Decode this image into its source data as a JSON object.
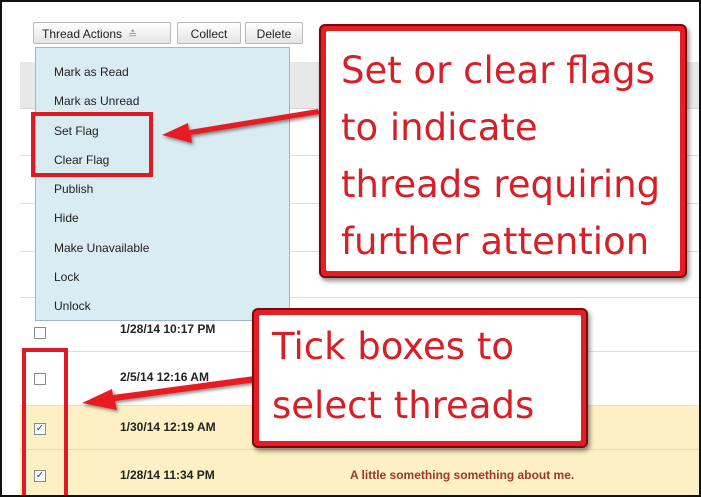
{
  "toolbar": {
    "thread_actions_label": "Thread Actions",
    "collect_label": "Collect",
    "delete_label": "Delete"
  },
  "menu": {
    "items": [
      "Mark as Read",
      "Mark as Unread",
      "Set Flag",
      "Clear Flag",
      "Publish",
      "Hide",
      "Make Unavailable",
      "Lock",
      "Unlock"
    ]
  },
  "threads": [
    {
      "date": "1/28/14 10:17 PM",
      "checked": false,
      "subject": ""
    },
    {
      "date": "2/5/14 12:16 AM",
      "checked": false,
      "subject": ""
    },
    {
      "date": "1/30/14 12:19 AM",
      "checked": true,
      "subject": ""
    },
    {
      "date": "1/28/14 11:34 PM",
      "checked": true,
      "subject": "A little something something about me."
    }
  ],
  "callouts": {
    "flags_lines": [
      "Set or clear flags",
      "to indicate",
      "threads requiring",
      "further attention"
    ],
    "tick_lines": [
      "Tick boxes to",
      "select threads"
    ]
  },
  "colors": {
    "annotation_red": "#e61e24",
    "selected_row": "#fdf0c4",
    "menu_bg": "#d9ecf2",
    "subject_text": "#a0362c"
  }
}
